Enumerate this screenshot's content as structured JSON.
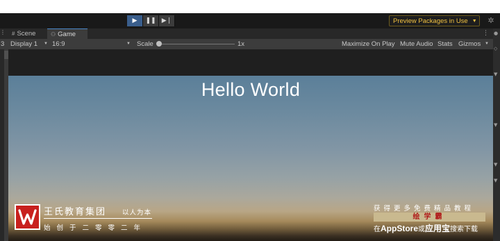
{
  "toolbar": {
    "play_icon": "play-icon",
    "pause_icon": "pause-icon",
    "step_icon": "step-icon",
    "preview_packages": "Preview Packages in Use",
    "settings_icon": "gear-icon"
  },
  "tabs": {
    "scene": "Scene",
    "game": "Game"
  },
  "game_bar": {
    "display_index": "3",
    "display": "Display 1",
    "aspect": "16:9",
    "scale_label": "Scale",
    "scale_value": "1x",
    "maximize": "Maximize On Play",
    "mute": "Mute Audio",
    "stats": "Stats",
    "gizmos": "Gizmos"
  },
  "viewport": {
    "text": "Hello World"
  },
  "watermark_left": {
    "logo_glyph": "W",
    "brand": "王氏教育集团",
    "slogan": "以人为本",
    "since": "始创于二零零二年"
  },
  "watermark_right": {
    "line1": "获得更多免费精品教程",
    "brand": "绘学霸",
    "line3_prefix": "在",
    "app_store": "AppStore",
    "line3_mid": "或",
    "app_bao": "应用宝",
    "line3_suffix": "搜索下载"
  },
  "colors": {
    "accent_play": "#3a5e8c",
    "preview_text": "#f0c040",
    "logo_red": "#c8201e"
  }
}
